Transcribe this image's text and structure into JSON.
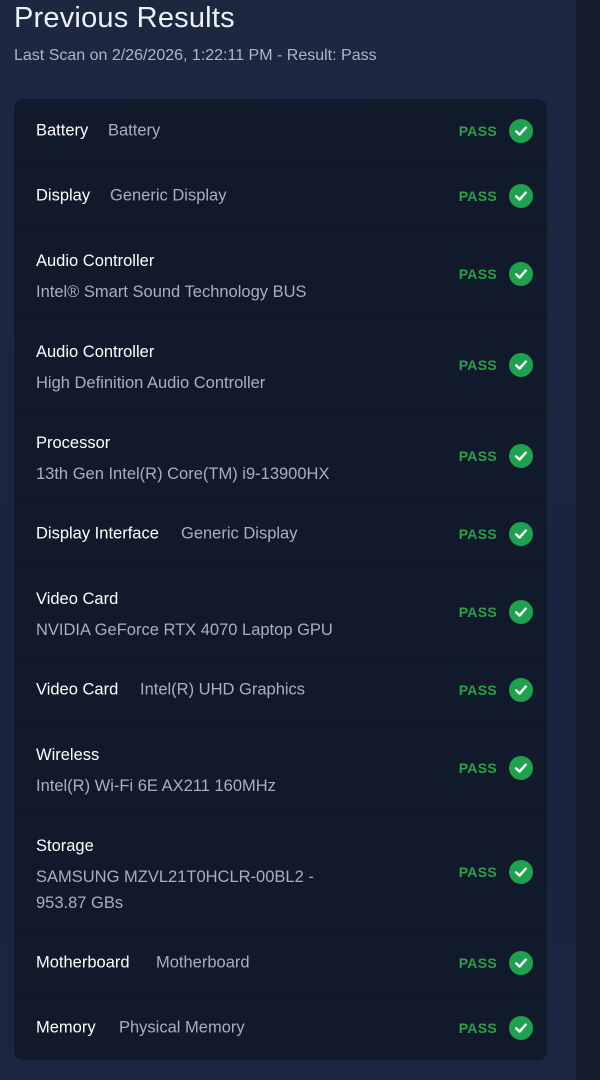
{
  "header": {
    "title": "Previous Results",
    "subtitle": "Last Scan on 2/26/2026, 1:22:11 PM - Result: Pass"
  },
  "status_label": "PASS",
  "colors": {
    "pass": "#2aa149",
    "check_bg": "#1ea24f",
    "panel": "#111a2b",
    "background": "#1c2740"
  },
  "results": [
    {
      "name": "Battery",
      "detail": "Battery",
      "status": "PASS",
      "icon": "check-circle-icon"
    },
    {
      "name": "Display",
      "detail": "Generic Display",
      "status": "PASS",
      "icon": "check-circle-icon"
    },
    {
      "name": "Audio Controller",
      "detail": "Intel® Smart Sound Technology BUS",
      "status": "PASS",
      "icon": "check-circle-icon"
    },
    {
      "name": "Audio Controller",
      "detail": "High Definition Audio Controller",
      "status": "PASS",
      "icon": "check-circle-icon"
    },
    {
      "name": "Processor",
      "detail": "13th Gen Intel(R) Core(TM) i9-13900HX",
      "status": "PASS",
      "icon": "check-circle-icon"
    },
    {
      "name": "Display Interface",
      "detail": "Generic Display",
      "status": "PASS",
      "icon": "check-circle-icon"
    },
    {
      "name": "Video Card",
      "detail": "NVIDIA GeForce RTX 4070 Laptop GPU",
      "status": "PASS",
      "icon": "check-circle-icon"
    },
    {
      "name": "Video Card",
      "detail": "Intel(R) UHD Graphics",
      "status": "PASS",
      "icon": "check-circle-icon"
    },
    {
      "name": "Wireless",
      "detail": "Intel(R) Wi-Fi 6E AX211 160MHz",
      "status": "PASS",
      "icon": "check-circle-icon"
    },
    {
      "name": "Storage",
      "detail": "SAMSUNG MZVL21T0HCLR-00BL2 - 953.87 GBs",
      "status": "PASS",
      "icon": "check-circle-icon"
    },
    {
      "name": "Motherboard",
      "detail": "Motherboard",
      "status": "PASS",
      "icon": "check-circle-icon"
    },
    {
      "name": "Memory",
      "detail": "Physical Memory",
      "status": "PASS",
      "icon": "check-circle-icon"
    }
  ]
}
